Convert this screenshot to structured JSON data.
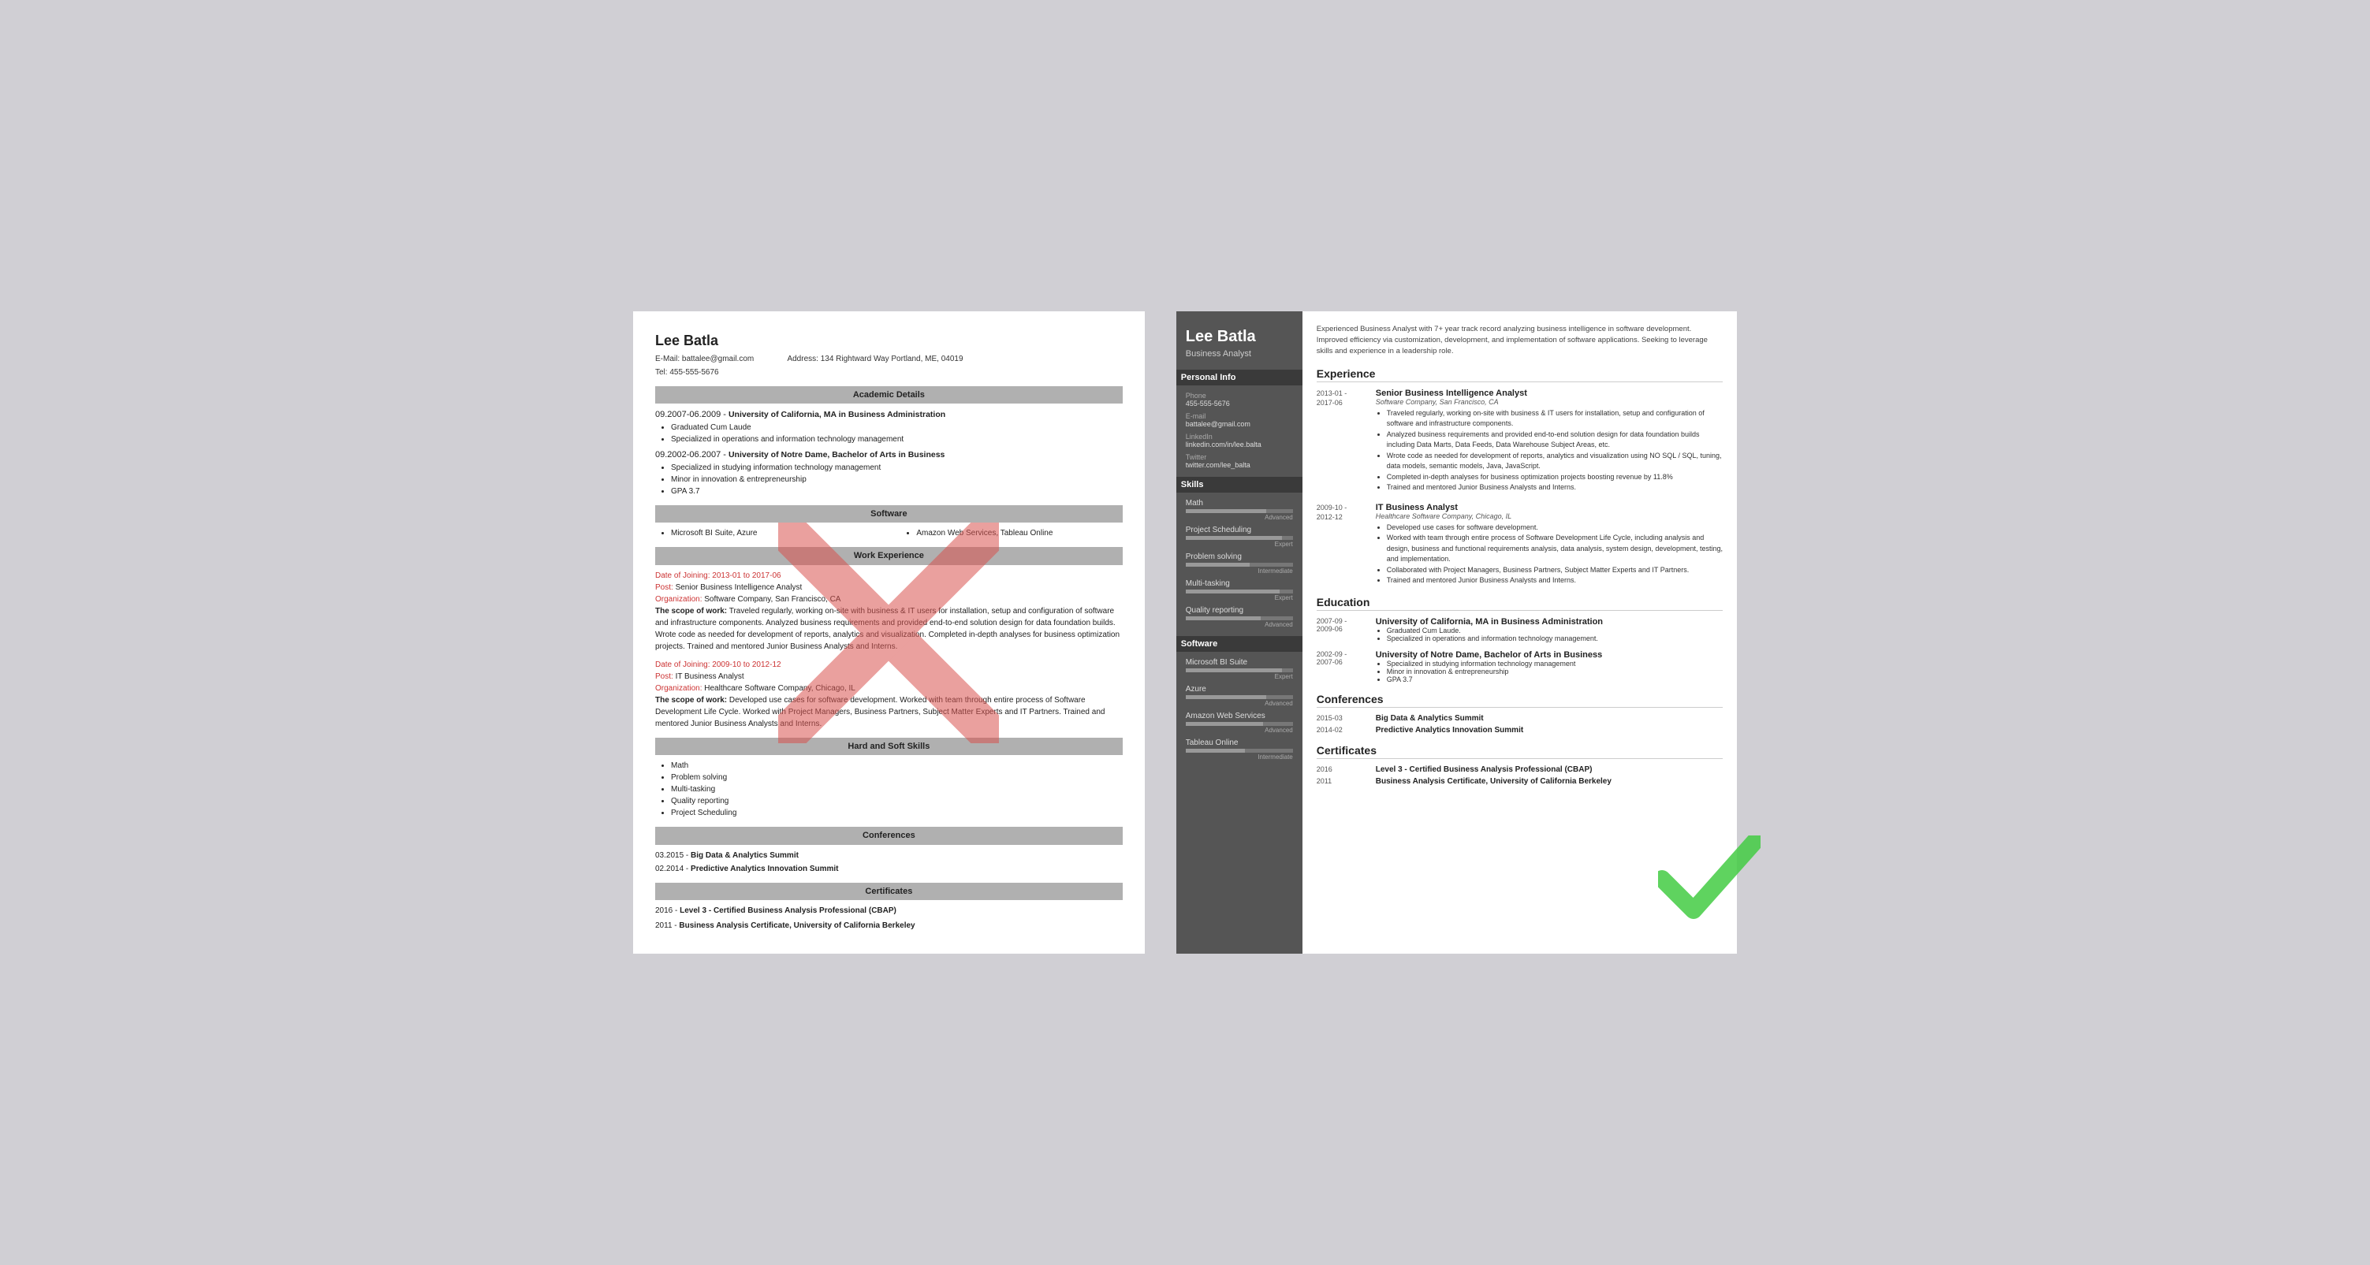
{
  "left": {
    "name": "Lee Batla",
    "email": "battalee@gmail.com",
    "tel": "Tel: 455-555-5676",
    "address": "Address: 134 Rightward Way Portland, ME, 04019",
    "sections": {
      "academic": "Academic Details",
      "software": "Software",
      "workExperience": "Work Experience",
      "hardSoftSkills": "Hard and Soft Skills",
      "conferences": "Conferences",
      "certificates": "Certificates"
    },
    "education": [
      {
        "dates": "09.2007-06.2009",
        "degree": "University of California, MA in Business Administration",
        "bullets": [
          "Graduated Cum Laude",
          "Specialized in operations and information technology management"
        ]
      },
      {
        "dates": "09.2002-06.2007",
        "degree": "University of Notre Dame, Bachelor of Arts in Business",
        "bullets": [
          "Specialized in studying information technology management",
          "Minor in innovation & entrepreneurship",
          "GPA 3.7"
        ]
      }
    ],
    "software": {
      "col1": [
        "Microsoft BI Suite, Azure"
      ],
      "col2": [
        "Amazon Web Services, Tableau Online"
      ]
    },
    "work": [
      {
        "dateLabel": "Date of Joining:",
        "dates": "2013-01 to 2017-06",
        "postLabel": "Post:",
        "post": "Senior Business Intelligence Analyst",
        "orgLabel": "Organization:",
        "org": "Software Company, San Francisco, CA",
        "scopeLabel": "The scope of work:",
        "scope": "Traveled regularly, working on-site with business & IT users for installation, setup and configuration of software and infrastructure components. Analyzed business requirements and provided end-to-end solution design for data foundation builds. Wrote code as needed for development of reports, analytics and visualization. Completed in-depth analyses for business optimization projects. Trained and mentored Junior Business Analysts and Interns."
      },
      {
        "dateLabel": "Date of Joining:",
        "dates": "2009-10 to 2012-12",
        "postLabel": "Post:",
        "post": "IT Business Analyst",
        "orgLabel": "Organization:",
        "org": "Healthcare Software Company, Chicago, IL",
        "scopeLabel": "The scope of work:",
        "scope": "Developed use cases for software development. Worked with team through entire process of Software Development Life Cycle. Worked with Project Managers, Business Partners, Subject Matter Experts and IT Partners. Trained and mentored Junior Business Analysts and Interns."
      }
    ],
    "skills": [
      "Math",
      "Problem solving",
      "Multi-tasking",
      "Quality reporting",
      "Project Scheduling"
    ],
    "conferences": [
      {
        "date": "03.2015",
        "name": "Big Data & Analytics Summit"
      },
      {
        "date": "02.2014",
        "name": "Predictive Analytics Innovation Summit"
      }
    ],
    "certificates": [
      {
        "year": "2016",
        "name": "Level 3 - Certified Business Analysis Professional (CBAP)"
      },
      {
        "year": "2011",
        "name": "Business Analysis Certificate, University of California Berkeley"
      }
    ]
  },
  "right": {
    "name": "Lee Batla",
    "title": "Business Analyst",
    "summary": "Experienced Business Analyst with 7+ year track record analyzing business intelligence in software development. Improved efficiency via customization, development, and implementation of software applications. Seeking to leverage skills and experience in a leadership role.",
    "sidebar": {
      "personalInfo": "Personal Info",
      "phone": {
        "label": "Phone",
        "value": "455-555-5676"
      },
      "email": {
        "label": "E-mail",
        "value": "battalee@gmail.com"
      },
      "linkedin": {
        "label": "LinkedIn",
        "value": "linkedin.com/in/lee.balta"
      },
      "twitter": {
        "label": "Twitter",
        "value": "twitter.com/lee_balta"
      },
      "skills": "Skills",
      "skillItems": [
        {
          "name": "Math",
          "fill": 75,
          "level": "Advanced"
        },
        {
          "name": "Project Scheduling",
          "fill": 90,
          "level": "Expert"
        },
        {
          "name": "Problem solving",
          "fill": 60,
          "level": "Intermediate"
        },
        {
          "name": "Multi-tasking",
          "fill": 88,
          "level": "Expert"
        },
        {
          "name": "Quality reporting",
          "fill": 70,
          "level": "Advanced"
        }
      ],
      "software": "Software",
      "softwareItems": [
        {
          "name": "Microsoft BI Suite",
          "fill": 90,
          "level": "Expert"
        },
        {
          "name": "Azure",
          "fill": 75,
          "level": "Advanced"
        },
        {
          "name": "Amazon Web Services",
          "fill": 72,
          "level": "Advanced"
        },
        {
          "name": "Tableau Online",
          "fill": 55,
          "level": "Intermediate"
        }
      ]
    },
    "sections": {
      "experience": "Experience",
      "education": "Education",
      "conferences": "Conferences",
      "certificates": "Certificates"
    },
    "experience": [
      {
        "dateFrom": "2013-01 -",
        "dateTo": "2017-06",
        "title": "Senior Business Intelligence Analyst",
        "company": "Software Company, San Francisco, CA",
        "bullets": [
          "Traveled regularly, working on-site with business & IT users for installation, setup and configuration of software and infrastructure components.",
          "Analyzed business requirements and provided end-to-end solution design for data foundation builds including Data Marts, Data Feeds, Data Warehouse Subject Areas, etc.",
          "Wrote code as needed for development of reports, analytics and visualization using NO SQL / SQL, tuning, data models, semantic models, Java, JavaScript.",
          "Completed in-depth analyses for business optimization projects boosting revenue by 11.8%",
          "Trained and mentored Junior Business Analysts and Interns."
        ]
      },
      {
        "dateFrom": "2009-10 -",
        "dateTo": "2012-12",
        "title": "IT Business Analyst",
        "company": "Healthcare Software Company, Chicago, IL",
        "bullets": [
          "Developed use cases for software development.",
          "Worked with team through entire process of Software Development Life Cycle, including analysis and design, business and functional requirements analysis, data analysis, system design, development, testing, and implementation.",
          "Collaborated with Project Managers, Business Partners, Subject Matter Experts and IT Partners.",
          "Trained and mentored Junior Business Analysts and Interns."
        ]
      }
    ],
    "education": [
      {
        "dateFrom": "2007-09 -",
        "dateTo": "2009-06",
        "school": "University of California, MA in Business Administration",
        "bullets": [
          "Graduated Cum Laude.",
          "Specialized in operations and information technology management."
        ]
      },
      {
        "dateFrom": "2002-09 -",
        "dateTo": "2007-06",
        "school": "University of Notre Dame, Bachelor of Arts in Business",
        "bullets": [
          "Specialized in studying information technology management",
          "Minor in innovation & entrepreneurship",
          "GPA 3.7"
        ]
      }
    ],
    "conferences": [
      {
        "date": "2015-03",
        "name": "Big Data & Analytics Summit"
      },
      {
        "date": "2014-02",
        "name": "Predictive Analytics Innovation Summit"
      }
    ],
    "certificates": [
      {
        "year": "2016",
        "name": "Level 3 - Certified Business Analysis Professional (CBAP)"
      },
      {
        "year": "2011",
        "name": "Business Analysis Certificate, University of California Berkeley"
      }
    ]
  }
}
